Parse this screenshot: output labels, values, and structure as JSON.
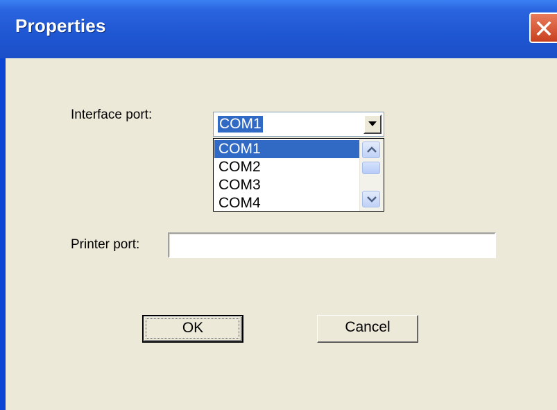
{
  "window": {
    "title": "Properties"
  },
  "form": {
    "interface_port_label": "Interface port:",
    "interface_port_value": "COM1",
    "interface_port_options": [
      "COM1",
      "COM2",
      "COM3",
      "COM4"
    ],
    "printer_port_label": "Printer port:",
    "printer_port_value": ""
  },
  "buttons": {
    "ok": "OK",
    "cancel": "Cancel"
  },
  "colors": {
    "titlebar": "#1f56d2",
    "selection": "#316ac5",
    "dialog_bg": "#ece9d8",
    "close": "#d9542f"
  },
  "icons": {
    "close": "close-icon",
    "combo_arrow": "chevron-down-icon",
    "scroll_up": "chevron-up-icon",
    "scroll_down": "chevron-down-icon"
  }
}
